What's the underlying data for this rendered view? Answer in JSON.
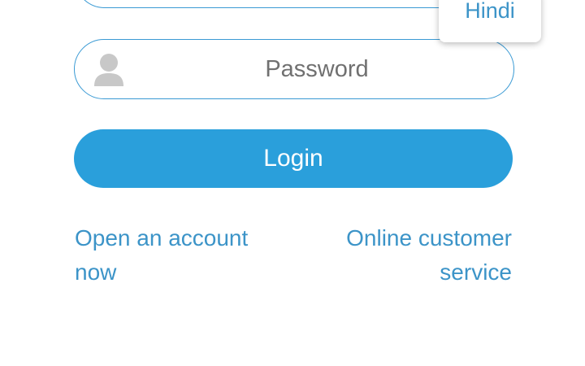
{
  "login_form": {
    "password_placeholder": "Password",
    "login_label": "Login",
    "open_account_label": "Open an account now",
    "customer_service_label": "Online customer service"
  },
  "language_menu": {
    "options": [
      "Hindi"
    ]
  },
  "icons": {
    "password_field_icon": "user-icon"
  },
  "colors": {
    "accent": "#2a9fdb",
    "link": "#3c94c8",
    "border": "#3a9ad4",
    "placeholder": "#707070",
    "icon": "#c8c8c8"
  }
}
